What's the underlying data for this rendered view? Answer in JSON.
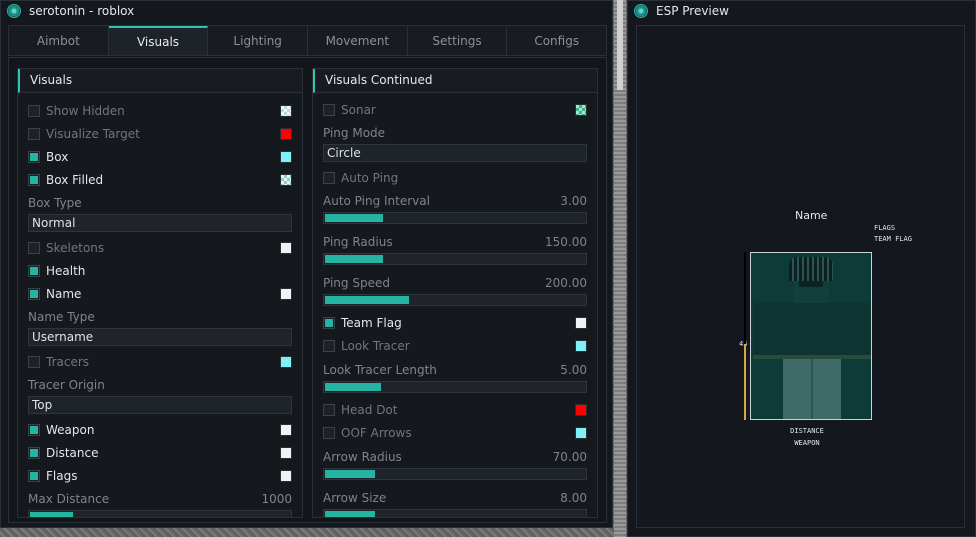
{
  "main_window": {
    "title": "serotonin - roblox"
  },
  "tabs": [
    {
      "label": "Aimbot",
      "active": false
    },
    {
      "label": "Visuals",
      "active": true
    },
    {
      "label": "Lighting",
      "active": false
    },
    {
      "label": "Movement",
      "active": false
    },
    {
      "label": "Settings",
      "active": false
    },
    {
      "label": "Configs",
      "active": false
    }
  ],
  "visuals": {
    "title": "Visuals",
    "show_hidden": {
      "label": "Show Hidden",
      "checked": false
    },
    "visualize_target": {
      "label": "Visualize Target",
      "checked": false,
      "color": "#ff0000"
    },
    "box": {
      "label": "Box",
      "checked": true,
      "color": "#7ff0f5"
    },
    "box_filled": {
      "label": "Box Filled",
      "checked": true
    },
    "box_type": {
      "label": "Box Type",
      "value": "Normal"
    },
    "skeletons": {
      "label": "Skeletons",
      "checked": false,
      "color": "#f2f2f2"
    },
    "health": {
      "label": "Health",
      "checked": true
    },
    "name": {
      "label": "Name",
      "checked": true,
      "color": "#f2f2f2"
    },
    "name_type": {
      "label": "Name Type",
      "value": "Username"
    },
    "tracers": {
      "label": "Tracers",
      "checked": false,
      "color": "#7ff0f5"
    },
    "tracer_origin": {
      "label": "Tracer Origin",
      "value": "Top"
    },
    "weapon": {
      "label": "Weapon",
      "checked": true,
      "color": "#f2f2f2"
    },
    "distance": {
      "label": "Distance",
      "checked": true,
      "color": "#f2f2f2"
    },
    "flags": {
      "label": "Flags",
      "checked": true,
      "color": "#f2f2f2"
    },
    "max_distance": {
      "label": "Max Distance",
      "value": "1000",
      "fill": 0.17
    }
  },
  "visuals_continued": {
    "title": "Visuals Continued",
    "sonar": {
      "label": "Sonar",
      "checked": false
    },
    "ping_mode": {
      "label": "Ping Mode",
      "value": "Circle"
    },
    "auto_ping": {
      "label": "Auto Ping",
      "checked": false
    },
    "auto_ping_interval": {
      "label": "Auto Ping Interval",
      "value": "3.00",
      "fill": 0.23
    },
    "ping_radius": {
      "label": "Ping Radius",
      "value": "150.00",
      "fill": 0.23
    },
    "ping_speed": {
      "label": "Ping Speed",
      "value": "200.00",
      "fill": 0.33
    },
    "team_flag": {
      "label": "Team Flag",
      "checked": true,
      "color": "#f2f2f2"
    },
    "look_tracer": {
      "label": "Look Tracer",
      "checked": false,
      "color": "#7ff0f5"
    },
    "look_tracer_length": {
      "label": "Look Tracer Length",
      "value": "5.00",
      "fill": 0.22
    },
    "head_dot": {
      "label": "Head Dot",
      "checked": false,
      "color": "#ff0000"
    },
    "oof_arrows": {
      "label": "OOF Arrows",
      "checked": false,
      "color": "#7ff0f5"
    },
    "arrow_radius": {
      "label": "Arrow Radius",
      "value": "70.00",
      "fill": 0.2
    },
    "arrow_size": {
      "label": "Arrow Size",
      "value": "8.00",
      "fill": 0.2
    }
  },
  "preview_window": {
    "title": "ESP Preview",
    "name": "Name",
    "flags": [
      "FLAGS",
      "TEAM FLAG"
    ],
    "bottom": [
      "DISTANCE",
      "WEAPON"
    ],
    "health_number": "45",
    "health_fill": 0.45
  },
  "colors": {
    "accent": "#25b3a2",
    "window_bg": "#14181e"
  }
}
